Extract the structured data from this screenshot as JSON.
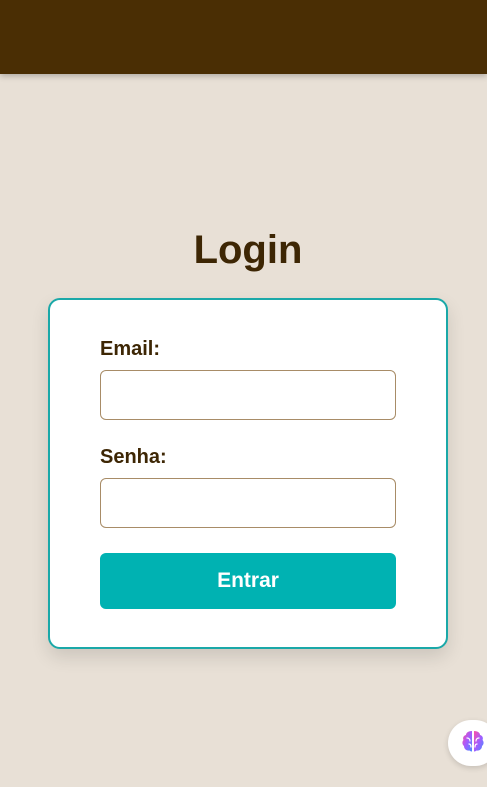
{
  "page": {
    "title": "Login"
  },
  "form": {
    "email_label": "Email:",
    "email_value": "",
    "email_placeholder": "",
    "password_label": "Senha:",
    "password_value": "",
    "password_placeholder": "",
    "submit_label": "Entrar"
  },
  "colors": {
    "header": "#4a2e04",
    "background": "#e8e0d6",
    "accent": "#00b2b2",
    "text": "#3d2604"
  },
  "floating_widget": {
    "icon": "brain-icon"
  }
}
